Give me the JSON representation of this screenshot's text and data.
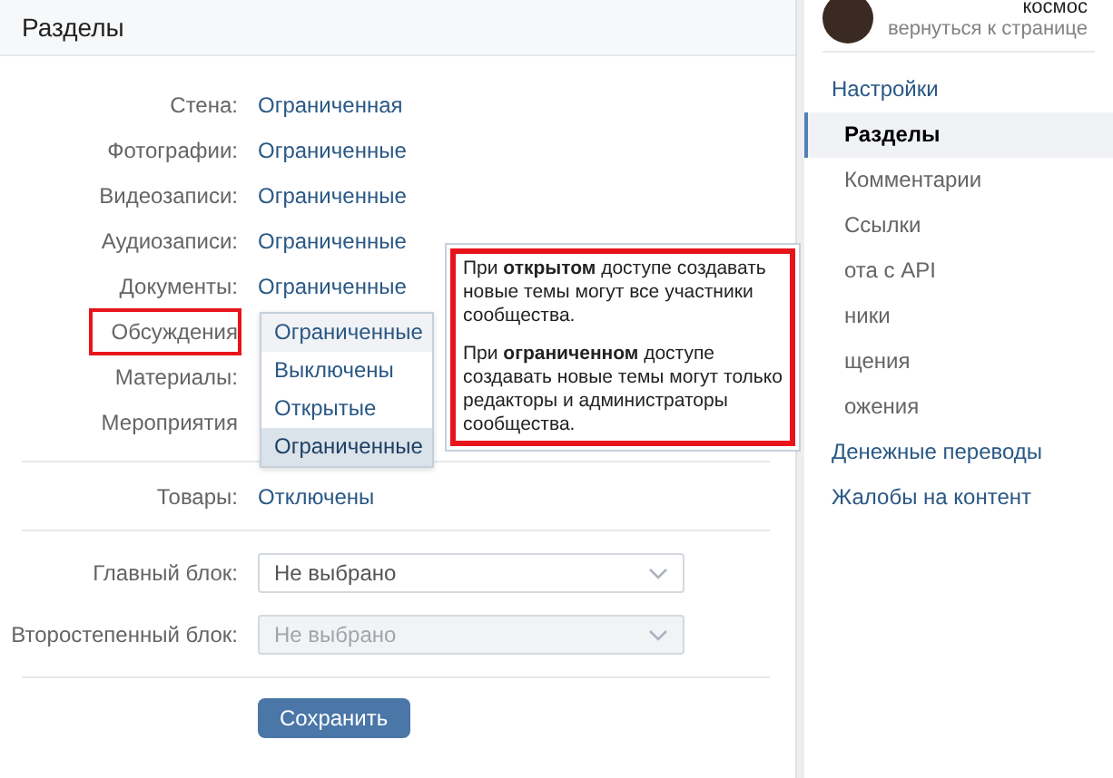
{
  "section": {
    "title": "Разделы"
  },
  "rows": [
    {
      "label": "Стена:",
      "value": "Ограниченная",
      "highlighted": false
    },
    {
      "label": "Фотографии:",
      "value": "Ограниченные",
      "highlighted": false
    },
    {
      "label": "Видеозаписи:",
      "value": "Ограниченные",
      "highlighted": false
    },
    {
      "label": "Аудиозаписи:",
      "value": "Ограниченные",
      "highlighted": false
    },
    {
      "label": "Документы:",
      "value": "Ограниченные",
      "highlighted": false
    },
    {
      "label": "Обсуждения",
      "highlighted": true
    },
    {
      "label": "Материалы:",
      "highlighted": false
    },
    {
      "label": "Мероприятия",
      "highlighted": false
    }
  ],
  "dropdown": {
    "options": [
      {
        "label": "Ограниченные",
        "hovered": true,
        "selected": false
      },
      {
        "label": "Выключены",
        "hovered": false,
        "selected": false
      },
      {
        "label": "Открытые",
        "hovered": false,
        "selected": false
      },
      {
        "label": "Ограниченные",
        "hovered": false,
        "selected": true
      }
    ]
  },
  "tooltip": {
    "highlighted": true,
    "paragraphs": [
      "При **открытом** доступе создавать новые темы могут все участники сообщества.",
      "При **ограниченном** доступе создавать новые темы могут только редакторы и администраторы сообщества."
    ]
  },
  "goods": {
    "label": "Товары:",
    "value": "Отключены"
  },
  "selects": [
    {
      "label": "Главный блок:",
      "placeholder": "Не выбрано",
      "disabled": false
    },
    {
      "label": "Второстепенный блок:",
      "placeholder": "Не выбрано",
      "disabled": true
    }
  ],
  "save_button": "Сохранить",
  "sidebar": {
    "profile": {
      "name": "космос",
      "link": "вернуться к странице"
    },
    "items": [
      {
        "label": "Настройки",
        "selected": false,
        "children": [
          {
            "label": "Разделы",
            "selected": true
          },
          {
            "label": "Комментарии",
            "selected": false
          },
          {
            "label": "Ссылки",
            "selected": false
          },
          {
            "label": "ота с API",
            "selected": false
          },
          {
            "label": "ники",
            "selected": false
          },
          {
            "label": "щения",
            "selected": false
          },
          {
            "label": "ожения",
            "selected": false
          }
        ]
      },
      {
        "label": "Денежные переводы",
        "selected": false
      },
      {
        "label": "Жалобы на контент",
        "selected": false
      }
    ]
  }
}
